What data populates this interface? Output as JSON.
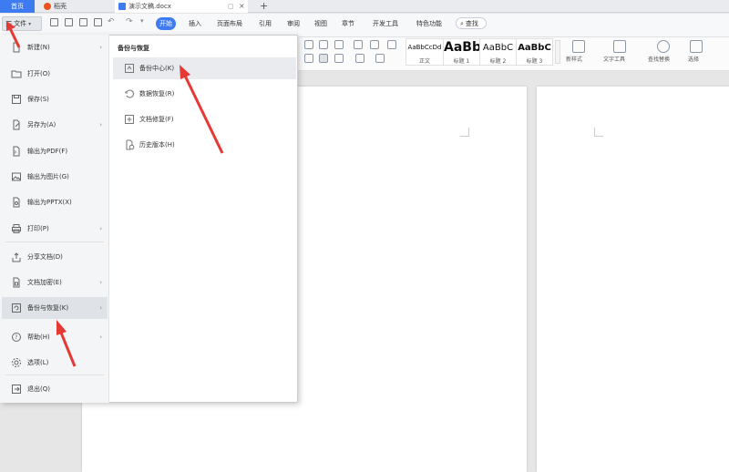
{
  "tabs": {
    "home": "首页",
    "daoke": "稻壳",
    "doc": "演示文稿.docx",
    "add": "+"
  },
  "toolbar": {
    "file_label": "文件",
    "menu_tabs": [
      "开始",
      "插入",
      "页面布局",
      "引用",
      "审阅",
      "视图",
      "章节",
      "开发工具",
      "特色功能"
    ],
    "search_label": "查找"
  },
  "ribbon": {
    "styles": [
      {
        "sample": "AaBbCcDd",
        "name": "正文"
      },
      {
        "sample": "AaBb",
        "name": "标题 1"
      },
      {
        "sample": "AaBbC",
        "name": "标题 2"
      },
      {
        "sample": "AaBbC",
        "name": "标题 3"
      }
    ],
    "tools": [
      "新样式",
      "文字工具",
      "查找替换",
      "选择"
    ]
  },
  "file_menu": {
    "items": [
      {
        "label": "新建(N)",
        "icon": "new-doc-icon",
        "arrow": true
      },
      {
        "label": "打开(O)",
        "icon": "open-folder-icon",
        "arrow": false
      },
      {
        "label": "保存(S)",
        "icon": "save-icon",
        "arrow": false
      },
      {
        "label": "另存为(A)",
        "icon": "save-as-icon",
        "arrow": true
      },
      {
        "label": "输出为PDF(F)",
        "icon": "pdf-icon",
        "arrow": false
      },
      {
        "label": "输出为图片(G)",
        "icon": "image-icon",
        "arrow": false
      },
      {
        "label": "输出为PPTX(X)",
        "icon": "pptx-icon",
        "arrow": false
      },
      {
        "label": "打印(P)",
        "icon": "print-icon",
        "arrow": true
      },
      {
        "label": "分享文档(D)",
        "icon": "share-icon",
        "arrow": false
      },
      {
        "label": "文档加密(E)",
        "icon": "encrypt-icon",
        "arrow": true
      },
      {
        "label": "备份与恢复(K)",
        "icon": "backup-icon",
        "arrow": true
      },
      {
        "label": "帮助(H)",
        "icon": "help-icon",
        "arrow": true
      },
      {
        "label": "选项(L)",
        "icon": "options-icon",
        "arrow": false
      },
      {
        "label": "退出(Q)",
        "icon": "exit-icon",
        "arrow": false
      }
    ],
    "selected": "备份与恢复(K)"
  },
  "submenu": {
    "title": "备份与恢复",
    "items": [
      {
        "label": "备份中心(K)",
        "icon": "backup-center-icon"
      },
      {
        "label": "数据恢复(R)",
        "icon": "data-recovery-icon"
      },
      {
        "label": "文档修复(F)",
        "icon": "doc-repair-icon"
      },
      {
        "label": "历史版本(H)",
        "icon": "history-icon"
      }
    ],
    "selected": "备份中心(K)"
  },
  "colors": {
    "accent": "#3e7bf0",
    "arrow": "#e53935",
    "doc_tab_icon": "#3e7bf0",
    "daoke_icon": "#e8541e"
  }
}
